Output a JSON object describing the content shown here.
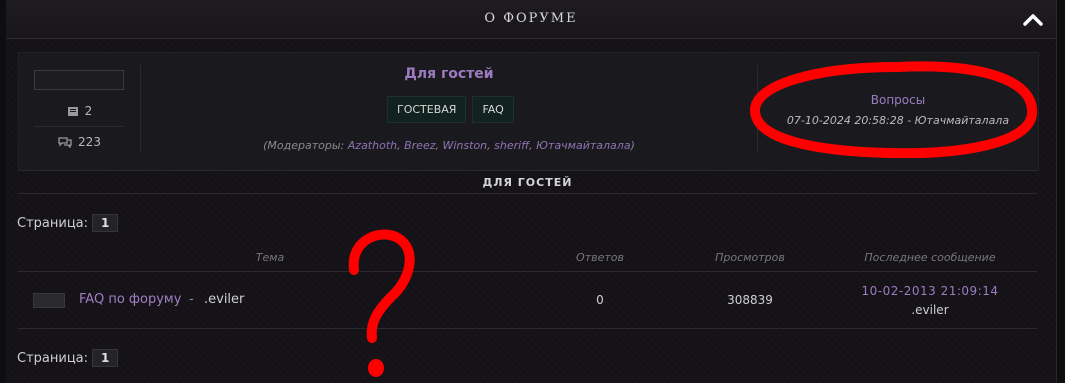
{
  "header": {
    "title": "О ФОРУМЕ",
    "collapse_icon": "chevron-up-icon"
  },
  "forum": {
    "name": "Для гостей",
    "topics_count": "2",
    "posts_count": "223",
    "tags": [
      "ГОСТЕВАЯ",
      "FAQ"
    ],
    "moderators_prefix": "(Модераторы: ",
    "moderators": [
      "Azathoth",
      "Breez",
      "Winston",
      "sheriff",
      "Ютачмайталала"
    ],
    "moderators_suffix": ")",
    "last_topic": "Вопросы",
    "last_meta": "07-10-2024 20:58:28 - Ютачмайталала"
  },
  "section": {
    "title": "ДЛЯ ГОСТЕЙ"
  },
  "pager": {
    "label": "Страница:",
    "current": "1"
  },
  "table": {
    "headers": {
      "topic": "Тема",
      "replies": "Ответов",
      "views": "Просмотров",
      "last": "Последнее сообщение"
    },
    "rows": [
      {
        "title": "FAQ по форуму",
        "separator": "-",
        "author": ".eviler",
        "replies": "0",
        "views": "308839",
        "last_date": "10-02-2013 21:09:14",
        "last_user": ".eviler"
      }
    ]
  },
  "colors": {
    "accent": "#9c7bc0",
    "annotation": "#ff0000",
    "tag_bg": "#12221f"
  }
}
